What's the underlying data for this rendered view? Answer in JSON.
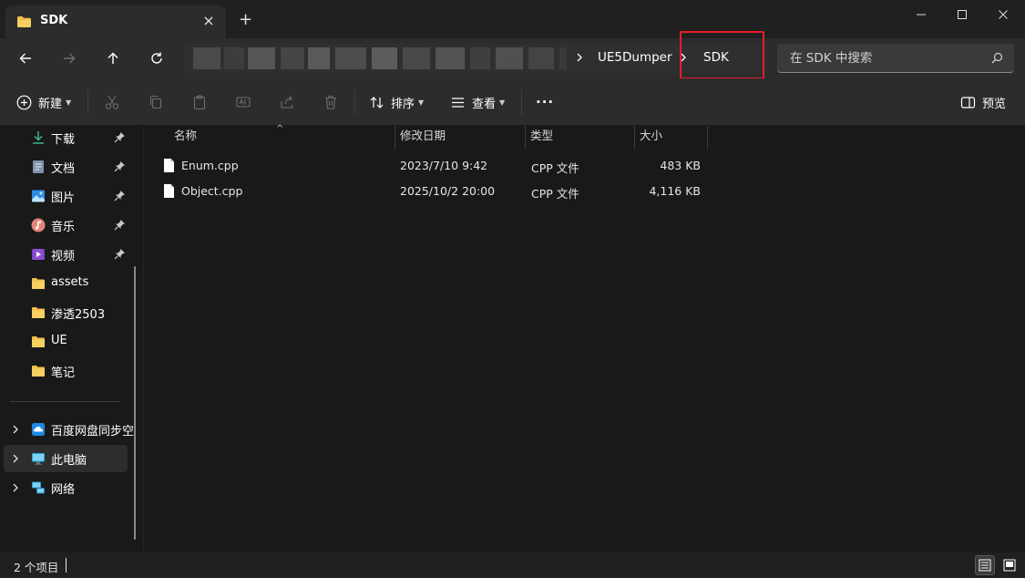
{
  "window": {
    "tab_title": "SDK",
    "new_tab_label": "+",
    "tab_close_label": "×"
  },
  "address": {
    "breadcrumbs": [
      "UE5Dumper",
      "SDK"
    ],
    "search_placeholder": "在 SDK 中搜索"
  },
  "toolbar": {
    "new_label": "新建",
    "sort_label": "排序",
    "view_label": "查看",
    "more_label": "...",
    "preview_label": "预览"
  },
  "sidebar": {
    "quick_access": [
      {
        "label": "下载",
        "icon": "download-icon",
        "pinned": true
      },
      {
        "label": "文档",
        "icon": "document-icon",
        "pinned": true
      },
      {
        "label": "图片",
        "icon": "picture-icon",
        "pinned": true
      },
      {
        "label": "音乐",
        "icon": "music-icon",
        "pinned": true
      },
      {
        "label": "视频",
        "icon": "video-icon",
        "pinned": true
      },
      {
        "label": "assets",
        "icon": "folder-icon",
        "pinned": false
      },
      {
        "label": "渗透2503",
        "icon": "folder-icon",
        "pinned": false
      },
      {
        "label": "UE",
        "icon": "folder-icon",
        "pinned": false
      },
      {
        "label": "笔记",
        "icon": "folder-icon",
        "pinned": false
      }
    ],
    "locations": [
      {
        "label": "百度网盘同步空",
        "icon": "cloud-sync-icon",
        "selected": false
      },
      {
        "label": "此电脑",
        "icon": "computer-icon",
        "selected": true
      },
      {
        "label": "网络",
        "icon": "network-icon",
        "selected": false
      }
    ]
  },
  "file_list": {
    "columns": [
      "名称",
      "修改日期",
      "类型",
      "大小"
    ],
    "rows": [
      {
        "name": "Enum.cpp",
        "modified": "2023/7/10 9:42",
        "type": "CPP 文件",
        "size": "483 KB"
      },
      {
        "name": "Object.cpp",
        "modified": "2025/10/2 20:00",
        "type": "CPP 文件",
        "size": "4,116 KB"
      }
    ]
  },
  "status": {
    "item_count": "2 个项目"
  },
  "colors": {
    "accent_folder": "#f3c04c",
    "highlight_box": "#e81d2c",
    "background": "#191919"
  }
}
